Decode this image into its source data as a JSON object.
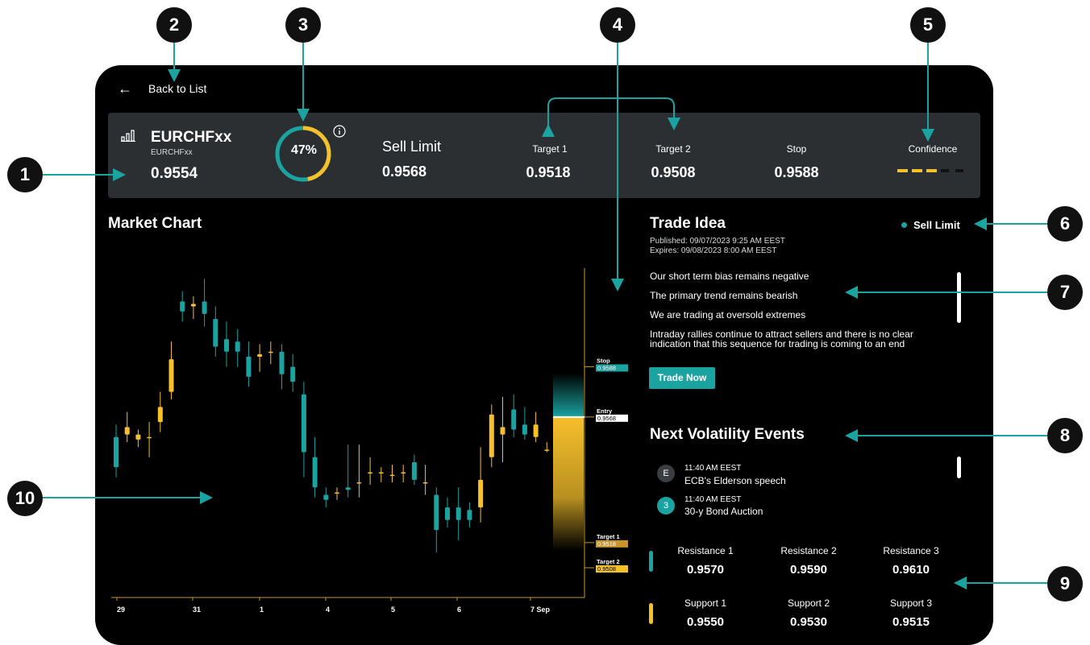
{
  "callouts": [
    "1",
    "2",
    "3",
    "4",
    "5",
    "6",
    "7",
    "8",
    "9",
    "10"
  ],
  "nav": {
    "back_icon": "arrow-left-icon",
    "back_label": "Back to List"
  },
  "summary": {
    "icon": "bar-chart-icon",
    "symbol": "EURCHFxx",
    "symbol_sub": "EURCHFxx",
    "price": "0.9554",
    "gauge_percent_label": "47%",
    "gauge_value": 0.47,
    "order_type": "Sell Limit",
    "order_price": "0.9568",
    "levels": [
      {
        "label": "Target 1",
        "value": "0.9518"
      },
      {
        "label": "Target 2",
        "value": "0.9508"
      },
      {
        "label": "Stop",
        "value": "0.9588"
      }
    ],
    "confidence_label": "Confidence",
    "confidence_level": 3,
    "confidence_max": 5
  },
  "market_chart": {
    "title": "Market Chart",
    "x_ticks": [
      "29",
      "31",
      "1",
      "4",
      "5",
      "6",
      "7 Sep"
    ],
    "markers": [
      {
        "name": "Stop",
        "value": "0.9588"
      },
      {
        "name": "Entry",
        "value": "0.9568"
      },
      {
        "name": "Target 1",
        "value": "0.9518"
      },
      {
        "name": "Target 2",
        "value": "0.9508"
      }
    ]
  },
  "trade_idea": {
    "title": "Trade Idea",
    "status": "Sell Limit",
    "published": "Published:  09/07/2023 9:25 AM EEST",
    "expires": "Expires:  09/08/2023 8:00 AM EEST",
    "bullets": [
      "Our short term bias remains negative",
      "The primary trend remains bearish",
      "We are trading at oversold extremes",
      "Intraday rallies continue to attract sellers and there is no clear indication that this sequence for trading is coming to an end"
    ],
    "button": "Trade Now"
  },
  "volatility": {
    "title": "Next Volatility Events",
    "events": [
      {
        "badge": "E",
        "time": "11:40 AM EEST",
        "title": "ECB's Elderson speech"
      },
      {
        "badge": "3",
        "time": "11:40 AM EEST",
        "title": "30-y Bond Auction"
      }
    ]
  },
  "levels_table": {
    "resistance": [
      {
        "label": "Resistance 1",
        "value": "0.9570"
      },
      {
        "label": "Resistance 2",
        "value": "0.9590"
      },
      {
        "label": "Resistance 3",
        "value": "0.9610"
      }
    ],
    "support": [
      {
        "label": "Support 1",
        "value": "0.9550"
      },
      {
        "label": "Support 2",
        "value": "0.9530"
      },
      {
        "label": "Support 3",
        "value": "0.9515"
      }
    ]
  },
  "colors": {
    "teal": "#1aa3a0",
    "yellow": "#f6c02b",
    "panel": "#2b2f31",
    "bg": "#000000"
  },
  "chart_data": {
    "type": "candlestick",
    "x_ticks": [
      "29",
      "31",
      "1",
      "4",
      "5",
      "6",
      "7 Sep"
    ],
    "levels": {
      "stop": 0.9588,
      "entry": 0.9568,
      "target_1": 0.9518,
      "target_2": 0.9508
    },
    "candles": [
      {
        "o": 0.956,
        "c": 0.9548,
        "h": 0.9565,
        "l": 0.9544
      },
      {
        "o": 0.9561,
        "c": 0.9564,
        "h": 0.957,
        "l": 0.9558
      },
      {
        "o": 0.9559,
        "c": 0.9561,
        "h": 0.9563,
        "l": 0.9556
      },
      {
        "o": 0.956,
        "c": 0.956,
        "h": 0.9566,
        "l": 0.9552
      },
      {
        "o": 0.9566,
        "c": 0.9572,
        "h": 0.9578,
        "l": 0.9562
      },
      {
        "o": 0.9578,
        "c": 0.9591,
        "h": 0.9598,
        "l": 0.9575
      },
      {
        "o": 0.9614,
        "c": 0.961,
        "h": 0.9618,
        "l": 0.9606
      },
      {
        "o": 0.9612,
        "c": 0.9613,
        "h": 0.9616,
        "l": 0.9607
      },
      {
        "o": 0.9614,
        "c": 0.9609,
        "h": 0.9623,
        "l": 0.9604
      },
      {
        "o": 0.9607,
        "c": 0.9596,
        "h": 0.9612,
        "l": 0.9592
      },
      {
        "o": 0.9599,
        "c": 0.9594,
        "h": 0.9606,
        "l": 0.9588
      },
      {
        "o": 0.9598,
        "c": 0.9594,
        "h": 0.9603,
        "l": 0.9588
      },
      {
        "o": 0.9592,
        "c": 0.9584,
        "h": 0.9598,
        "l": 0.958
      },
      {
        "o": 0.9592,
        "c": 0.9593,
        "h": 0.9597,
        "l": 0.9586
      },
      {
        "o": 0.9594,
        "c": 0.9594,
        "h": 0.9598,
        "l": 0.9589
      },
      {
        "o": 0.9594,
        "c": 0.9585,
        "h": 0.9597,
        "l": 0.9579
      },
      {
        "o": 0.9588,
        "c": 0.9582,
        "h": 0.9593,
        "l": 0.9578
      },
      {
        "o": 0.9577,
        "c": 0.9554,
        "h": 0.9582,
        "l": 0.9544
      },
      {
        "o": 0.9552,
        "c": 0.954,
        "h": 0.956,
        "l": 0.9536
      },
      {
        "o": 0.9537,
        "c": 0.9535,
        "h": 0.954,
        "l": 0.9532
      },
      {
        "o": 0.9538,
        "c": 0.9538,
        "h": 0.954,
        "l": 0.9535
      },
      {
        "o": 0.954,
        "c": 0.9539,
        "h": 0.9557,
        "l": 0.9536
      },
      {
        "o": 0.9542,
        "c": 0.9542,
        "h": 0.9557,
        "l": 0.9536
      },
      {
        "o": 0.9546,
        "c": 0.9546,
        "h": 0.9552,
        "l": 0.9541
      },
      {
        "o": 0.9546,
        "c": 0.9546,
        "h": 0.9548,
        "l": 0.9542
      },
      {
        "o": 0.9545,
        "c": 0.9545,
        "h": 0.9549,
        "l": 0.9542
      },
      {
        "o": 0.9546,
        "c": 0.9546,
        "h": 0.9549,
        "l": 0.9542
      },
      {
        "o": 0.955,
        "c": 0.9543,
        "h": 0.9553,
        "l": 0.9541
      },
      {
        "o": 0.9542,
        "c": 0.9542,
        "h": 0.9549,
        "l": 0.9537
      },
      {
        "o": 0.9537,
        "c": 0.9523,
        "h": 0.954,
        "l": 0.9514
      },
      {
        "o": 0.9532,
        "c": 0.9527,
        "h": 0.9536,
        "l": 0.9524
      },
      {
        "o": 0.9532,
        "c": 0.9527,
        "h": 0.954,
        "l": 0.9519
      },
      {
        "o": 0.9531,
        "c": 0.9527,
        "h": 0.9534,
        "l": 0.9524
      },
      {
        "o": 0.9532,
        "c": 0.9543,
        "h": 0.9556,
        "l": 0.9526
      },
      {
        "o": 0.9552,
        "c": 0.9569,
        "h": 0.9573,
        "l": 0.9548
      },
      {
        "o": 0.9561,
        "c": 0.9564,
        "h": 0.9576,
        "l": 0.955
      },
      {
        "o": 0.9571,
        "c": 0.9563,
        "h": 0.9577,
        "l": 0.956
      },
      {
        "o": 0.9565,
        "c": 0.9561,
        "h": 0.9572,
        "l": 0.9559
      },
      {
        "o": 0.956,
        "c": 0.9565,
        "h": 0.957,
        "l": 0.9558
      },
      {
        "o": 0.9555,
        "c": 0.9555,
        "h": 0.9558,
        "l": 0.9554
      }
    ]
  }
}
